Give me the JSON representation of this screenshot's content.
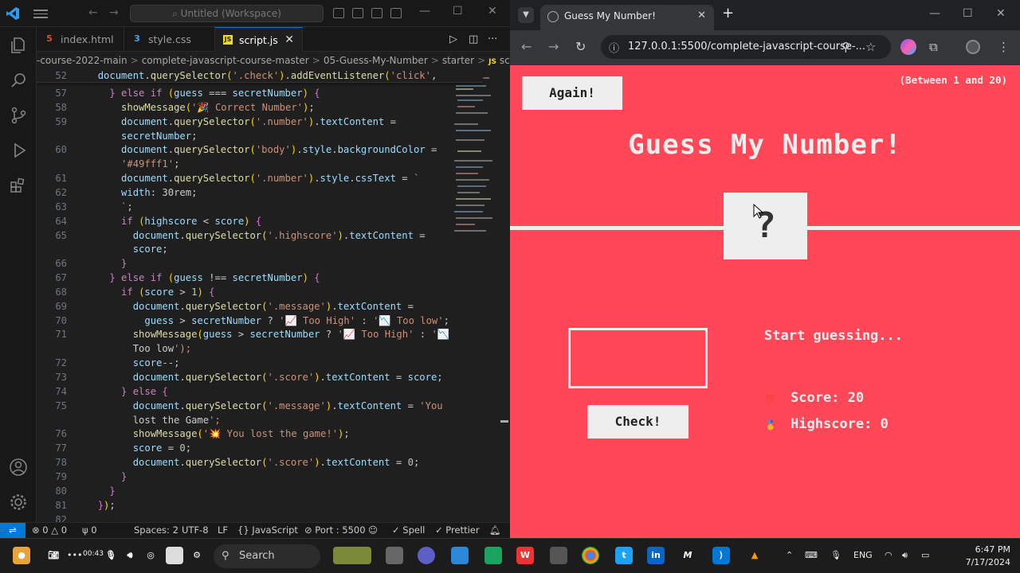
{
  "vscode": {
    "search_placeholder": "Untitled (Workspace)",
    "tabs": [
      {
        "label": "index.html",
        "icon": "html-file-icon"
      },
      {
        "label": "style.css",
        "icon": "css-file-icon"
      },
      {
        "label": "script.js",
        "icon": "js-file-icon",
        "active": true
      }
    ],
    "breadcrumb": [
      "-course-2022-main",
      "complete-javascript-course-master",
      "05-Guess-My-Number",
      "starter",
      "script.js",
      "..."
    ],
    "status": {
      "errors": "0",
      "warnings": "0",
      "ports": "0",
      "spaces": "Spaces: 2",
      "encoding": "UTF-8",
      "eol": "LF",
      "language": "JavaScript",
      "port": "Port : 5500",
      "spell": "Spell",
      "prettier": "Prettier"
    },
    "lines": [
      {
        "n": "52",
        "t": "  document.querySelector('.check').addEventListener('click',"
      },
      {
        "n": "57",
        "t": "    } else if (guess === secretNumber) {"
      },
      {
        "n": "58",
        "t": "      showMessage('🎉 Correct Number');"
      },
      {
        "n": "59",
        "t": "      document.querySelector('.number').textContent ="
      },
      {
        "n": "",
        "t": "      secretNumber;"
      },
      {
        "n": "60",
        "t": "      document.querySelector('body').style.backgroundColor ="
      },
      {
        "n": "",
        "t": "      '#49fff1';"
      },
      {
        "n": "61",
        "t": "      document.querySelector('.number').style.cssText = `"
      },
      {
        "n": "62",
        "t": "      width: 30rem;"
      },
      {
        "n": "63",
        "t": "      `;"
      },
      {
        "n": "64",
        "t": "      if (highscore < score) {"
      },
      {
        "n": "65",
        "t": "        document.querySelector('.highscore').textContent ="
      },
      {
        "n": "",
        "t": "        score;"
      },
      {
        "n": "66",
        "t": "      }"
      },
      {
        "n": "67",
        "t": "    } else if (guess !== secretNumber) {"
      },
      {
        "n": "68",
        "t": "      if (score > 1) {"
      },
      {
        "n": "69",
        "t": "        document.querySelector('.message').textContent ="
      },
      {
        "n": "70",
        "t": "          guess > secretNumber ? '📈 Too High' : '📉 Too low';"
      },
      {
        "n": "71",
        "t": "        showMessage(guess > secretNumber ? '📈 Too High' : '📉"
      },
      {
        "n": "",
        "t": "        Too low');"
      },
      {
        "n": "72",
        "t": "        score--;"
      },
      {
        "n": "73",
        "t": "        document.querySelector('.score').textContent = score;"
      },
      {
        "n": "74",
        "t": "      } else {"
      },
      {
        "n": "75",
        "t": "        document.querySelector('.message').textContent = 'You"
      },
      {
        "n": "",
        "t": "        lost the Game';"
      },
      {
        "n": "76",
        "t": "        showMessage('💥 You lost the game!');"
      },
      {
        "n": "77",
        "t": "        score = 0;"
      },
      {
        "n": "78",
        "t": "        document.querySelector('.score').textContent = 0;"
      },
      {
        "n": "79",
        "t": "      }"
      },
      {
        "n": "80",
        "t": "    }"
      },
      {
        "n": "81",
        "t": "  });"
      },
      {
        "n": "82",
        "t": ""
      }
    ]
  },
  "chrome": {
    "tab_title": "Guess My Number!",
    "url": "127.0.0.1:5500/complete-javascript-course-..."
  },
  "game": {
    "again_label": "Again!",
    "between": "(Between 1 and 20)",
    "title": "Guess My Number!",
    "number": "?",
    "check_label": "Check!",
    "message": "Start guessing...",
    "score_label": "Score:",
    "score_value": "20",
    "highscore_label": "Highscore:",
    "highscore_value": "0",
    "bg_color": "#ff4757"
  },
  "taskbar": {
    "search": "Search",
    "recorder_time": "00:43",
    "lang": "ENG",
    "time": "6:47 PM",
    "date": "7/17/2024"
  }
}
